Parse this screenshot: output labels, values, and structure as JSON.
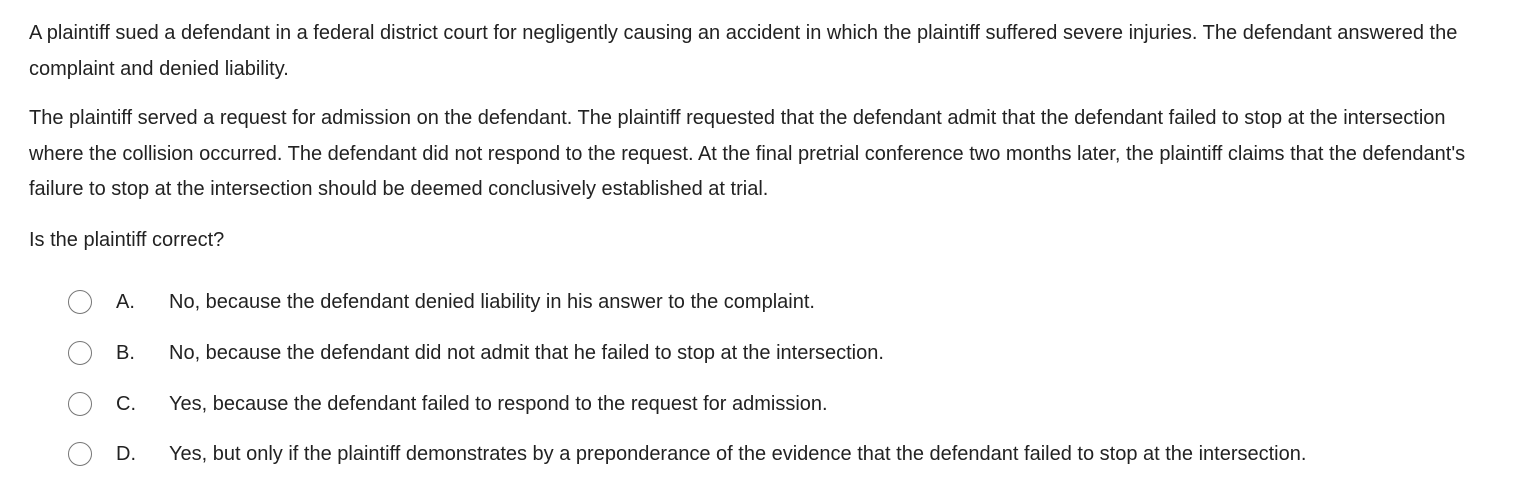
{
  "question": {
    "paragraphs": [
      "A plaintiff sued a defendant in a federal district court for negligently causing an accident in which the plaintiff suffered severe injuries.  The defendant answered the complaint and denied liability.",
      "The plaintiff served a request for admission on the defendant.  The plaintiff requested that the defendant admit that the defendant failed to stop at the intersection where the collision occurred.  The defendant did not respond to the request.  At the final pretrial conference two months later, the plaintiff claims that the defendant's failure to stop at the intersection should be deemed conclusively established at trial.",
      "Is the plaintiff correct?"
    ]
  },
  "options": [
    {
      "letter": "A.",
      "text": "No, because the defendant denied liability in his answer to the complaint.",
      "selected": false
    },
    {
      "letter": "B.",
      "text": "No, because the defendant did not admit that he failed to stop at the intersection.",
      "selected": false
    },
    {
      "letter": "C.",
      "text": "Yes, because the defendant failed to respond to the request for admission.",
      "selected": false
    },
    {
      "letter": "D.",
      "text": "Yes, but only if the plaintiff demonstrates by a preponderance of the evidence that the defendant failed to stop at the intersection.",
      "selected": false
    }
  ]
}
